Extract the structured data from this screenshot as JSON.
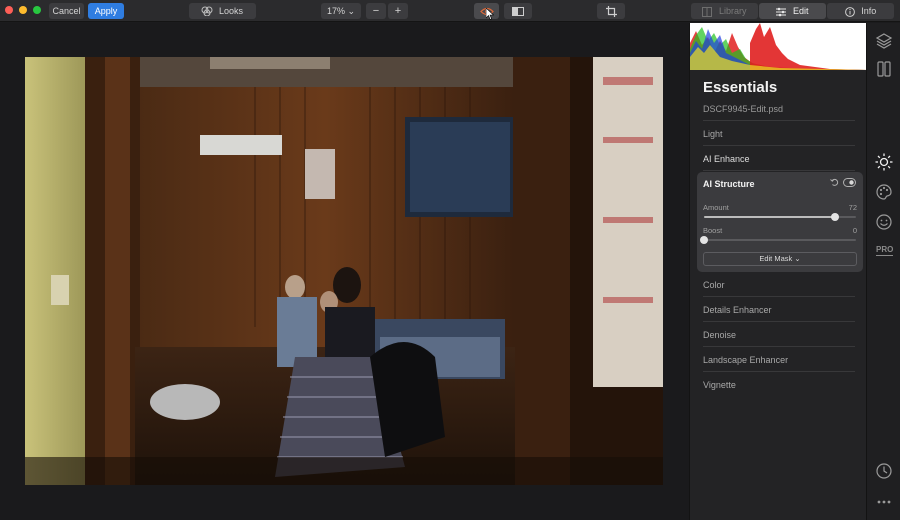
{
  "toolbar": {
    "cancel_label": "Cancel",
    "apply_label": "Apply",
    "looks_label": "Looks",
    "zoom_value": "17% ⌄",
    "zoom_minus": "−",
    "zoom_plus": "+",
    "tabs": [
      {
        "label": "Library"
      },
      {
        "label": "Edit"
      },
      {
        "label": "Info"
      }
    ]
  },
  "panel": {
    "title": "Essentials",
    "file_name": "DSCF9945-Edit.psd",
    "sections_top": [
      {
        "label": "Light"
      },
      {
        "label": "AI Enhance"
      }
    ],
    "ai_structure": {
      "title": "AI Structure",
      "sliders": [
        {
          "label": "Amount",
          "value": "72",
          "fraction": 0.86
        },
        {
          "label": "Boost",
          "value": "0",
          "fraction": 0.0
        }
      ],
      "mask_button": "Edit Mask ⌄"
    },
    "sections_bottom": [
      {
        "label": "Color"
      },
      {
        "label": "Details Enhancer"
      },
      {
        "label": "Denoise"
      },
      {
        "label": "Landscape Enhancer"
      },
      {
        "label": "Vignette"
      }
    ]
  },
  "iconbar": {
    "pro_label": "PRO"
  },
  "colors": {
    "accent": "#2f7de1",
    "panel_bg": "#232325",
    "card_bg": "#3b3b3e"
  }
}
